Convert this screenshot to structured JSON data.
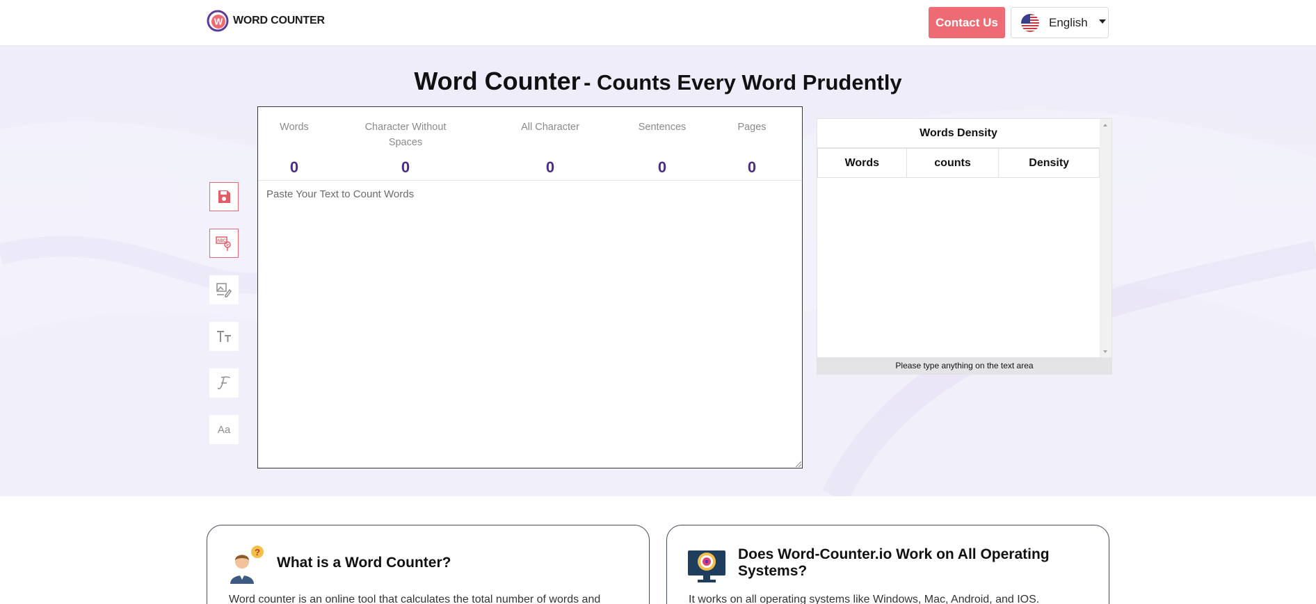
{
  "header": {
    "logo_text": "WORD COUNTER",
    "contact_label": "Contact Us",
    "language_label": "English"
  },
  "hero": {
    "title_main": "Word Counter",
    "title_sub": "- Counts Every Word Prudently"
  },
  "stats": [
    {
      "label": "Words",
      "value": "0"
    },
    {
      "label": "Character Without Spaces",
      "value": "0"
    },
    {
      "label": "All Character",
      "value": "0"
    },
    {
      "label": "Sentences",
      "value": "0"
    },
    {
      "label": "Pages",
      "value": "0"
    }
  ],
  "editor": {
    "placeholder": "Paste Your Text to Count Words"
  },
  "tools": [
    {
      "name": "save-icon",
      "active": true
    },
    {
      "name": "spell-check-icon",
      "active": true
    },
    {
      "name": "image-edit-icon",
      "active": false
    },
    {
      "name": "text-size-icon",
      "active": false
    },
    {
      "name": "font-icon",
      "active": false
    },
    {
      "name": "case-icon",
      "active": false
    }
  ],
  "density": {
    "title": "Words Density",
    "columns": [
      "Words",
      "counts",
      "Density"
    ],
    "empty_message": "Please type anything on the text area"
  },
  "cards": [
    {
      "title": "What is a Word Counter?",
      "text": "Word counter is an online tool that calculates the total number of words and"
    },
    {
      "title": "Does Word-Counter.io Work on All Operating Systems?",
      "text": "It works on all operating systems like Windows, Mac, Android, and IOS."
    }
  ],
  "colors": {
    "accent": "#ee6b73",
    "stat_value": "#4b2c86",
    "hero_bg": "#f2f1fb"
  }
}
